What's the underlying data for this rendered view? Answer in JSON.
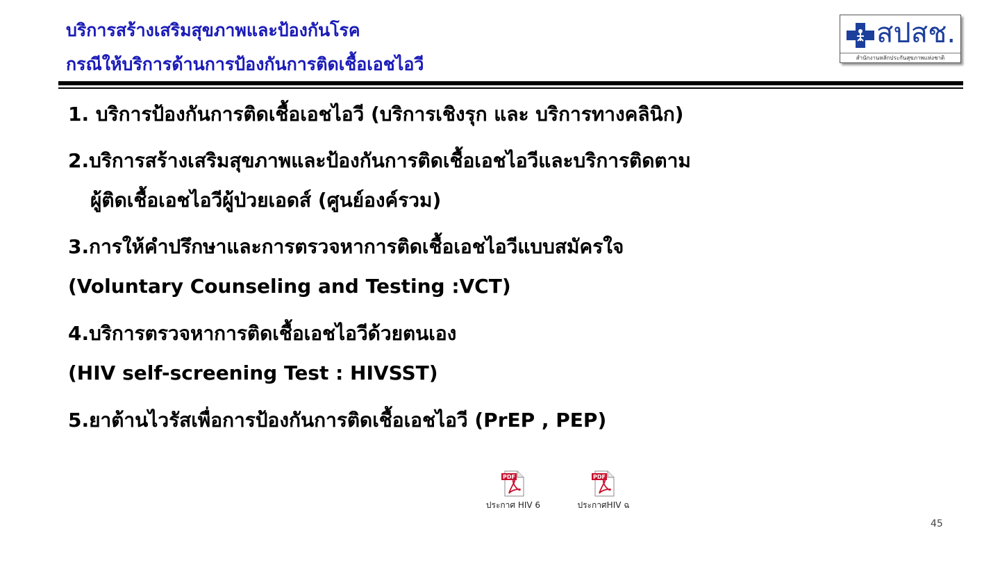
{
  "header": {
    "title_line1": "บริการสร้างเสริมสุขภาพและป้องกันโรค",
    "title_line2": "กรณีให้บริการด้านการป้องกันการติดเชื้อเอชไอวี"
  },
  "logo": {
    "wordmark": "สปสช.",
    "tagline": "สำนักงานหลักประกันสุขภาพแห่งชาติ",
    "brand_color": "#1d3f9c"
  },
  "items": [
    "1. บริการป้องกันการติดเชื้อเอชไอวี (บริการเชิงรุก  และ บริการทางคลินิก)",
    "2.บริการสร้างเสริมสุขภาพและป้องกันการติดเชื้อเอชไอวีและบริการติดตาม",
    "ผู้ติดเชื้อเอชไอวีผู้ป่วยเอดส์ (ศูนย์องค์รวม)",
    "3.การให้คำปรึกษาและการตรวจหาการติดเชื้อเอชไอวีแบบสมัครใจ",
    "(Voluntary Counseling and Testing :VCT)",
    "4.บริการตรวจหาการติดเชื้อเอชไอวีด้วยตนเอง",
    "(HIV self-screening Test : HIVSST)",
    "5.ยาต้านไวรัสเพื่อการป้องกันการติดเชื้อเอชไอวี (PrEP , PEP)"
  ],
  "attachments": [
    {
      "name": "ประกาศ HIV 6",
      "icon": "pdf-file-icon"
    },
    {
      "name": "ประกาศHIV ฉ",
      "icon": "pdf-file-icon"
    }
  ],
  "pdf_badge": "PDF",
  "page_number": "45",
  "colors": {
    "title": "#1a1ab8",
    "pdf_red": "#c8102e"
  }
}
